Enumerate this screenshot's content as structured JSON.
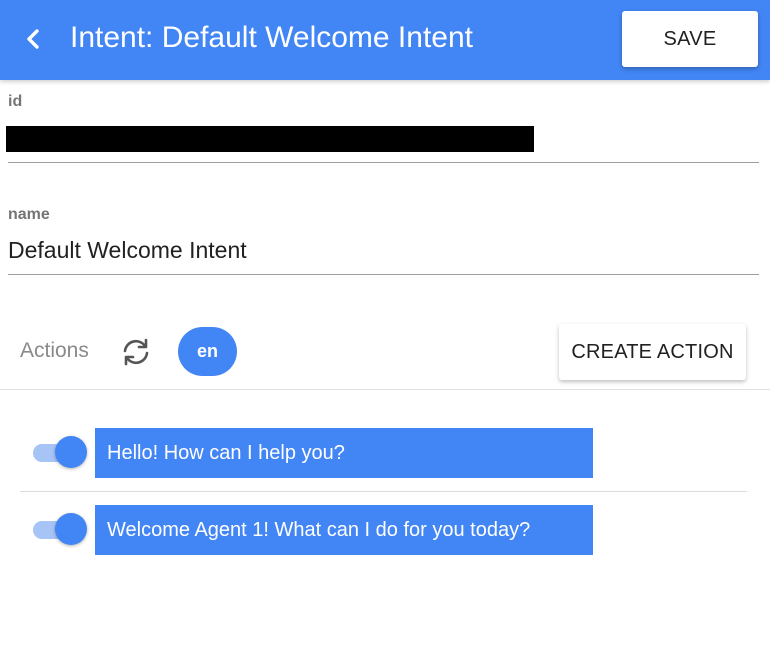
{
  "header": {
    "title": "Intent: Default Welcome Intent",
    "back_icon": "chevron-left-icon",
    "save_label": "SAVE",
    "accent_color": "#4285f4"
  },
  "form": {
    "id": {
      "label": "id",
      "value_redacted": true
    },
    "name": {
      "label": "name",
      "value": "Default Welcome Intent"
    }
  },
  "actions": {
    "label": "Actions",
    "sync_icon": "sync-icon",
    "language": "en",
    "create_label": "CREATE ACTION",
    "items": [
      {
        "enabled": true,
        "text": "Hello! How can I help you?"
      },
      {
        "enabled": true,
        "text": "Welcome Agent 1! What can I do for you today?"
      }
    ]
  }
}
